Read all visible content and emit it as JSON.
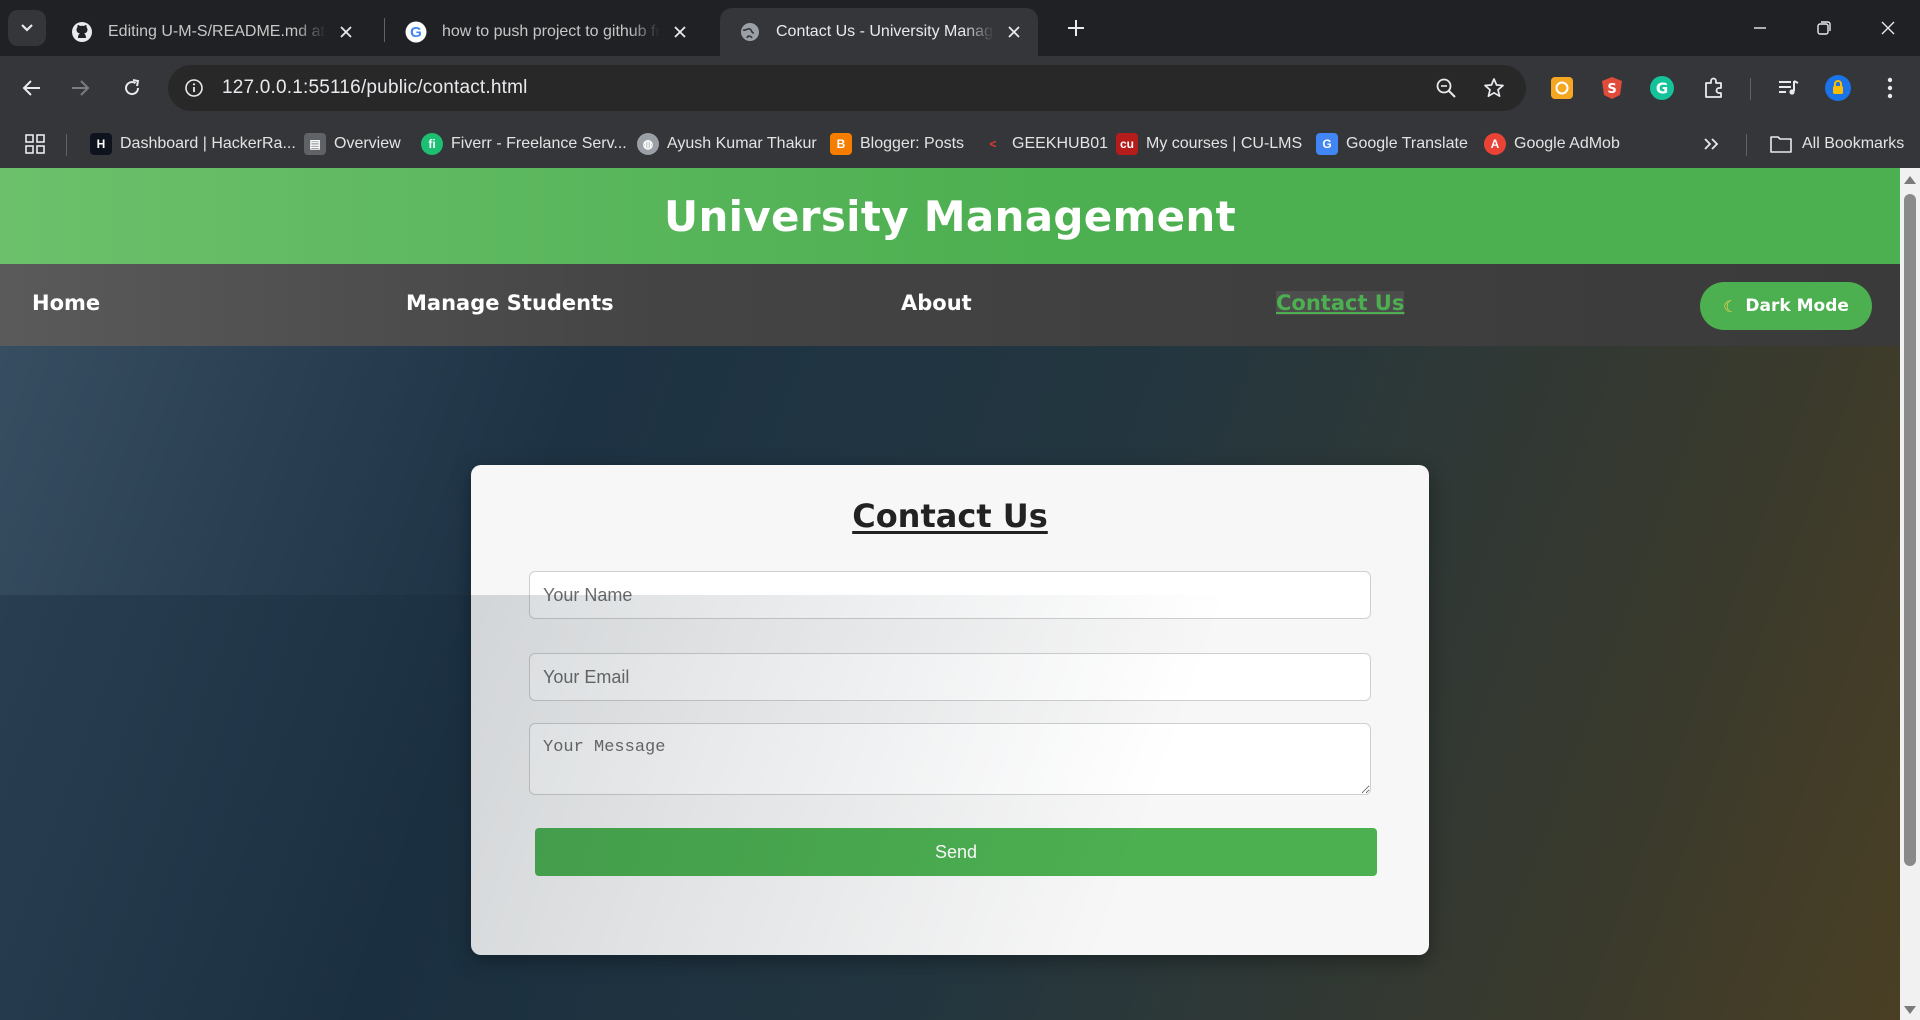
{
  "browser": {
    "tabs": [
      {
        "title": "Editing U-M-S/README.md at main",
        "favicon": "github-icon"
      },
      {
        "title": "how to push project to github from",
        "favicon": "google-icon"
      },
      {
        "title": "Contact Us - University Management",
        "favicon": "globe-icon",
        "active": true
      }
    ],
    "url": "127.0.0.1:55116/public/contact.html",
    "bookmarks": [
      {
        "label": "Dashboard | HackerRa...",
        "icon": "hackerrank-icon",
        "color": "#0e141e"
      },
      {
        "label": "Overview",
        "icon": "overview-icon",
        "color": "#5f6368"
      },
      {
        "label": "Fiverr - Freelance Serv...",
        "icon": "fiverr-icon",
        "color": "#1dbf73"
      },
      {
        "label": "Ayush Kumar Thakur",
        "icon": "globe-icon",
        "color": "#9aa0a6"
      },
      {
        "label": "Blogger: Posts",
        "icon": "blogger-icon",
        "color": "#f57d00"
      },
      {
        "label": "GEEKHUB01",
        "icon": "geekhub-icon",
        "color": "#e53935"
      },
      {
        "label": "My courses | CU-LMS",
        "icon": "cu-icon",
        "color": "#b71c1c"
      },
      {
        "label": "Google Translate",
        "icon": "translate-icon",
        "color": "#4285f4"
      },
      {
        "label": "Google AdMob",
        "icon": "admob-icon",
        "color": "#ea4335"
      }
    ],
    "all_bookmarks_label": "All Bookmarks"
  },
  "site": {
    "title": "University Management",
    "nav": [
      {
        "label": "Home"
      },
      {
        "label": "Manage Students"
      },
      {
        "label": "About"
      },
      {
        "label": "Contact Us",
        "active": true
      }
    ],
    "dark_mode_label": "Dark Mode",
    "dark_mode_icon": "moon-icon",
    "accent_color": "#4caf50"
  },
  "contact": {
    "title": "Contact Us",
    "name_placeholder": "Your Name",
    "email_placeholder": "Your Email",
    "message_placeholder": "Your Message",
    "send_label": "Send"
  }
}
